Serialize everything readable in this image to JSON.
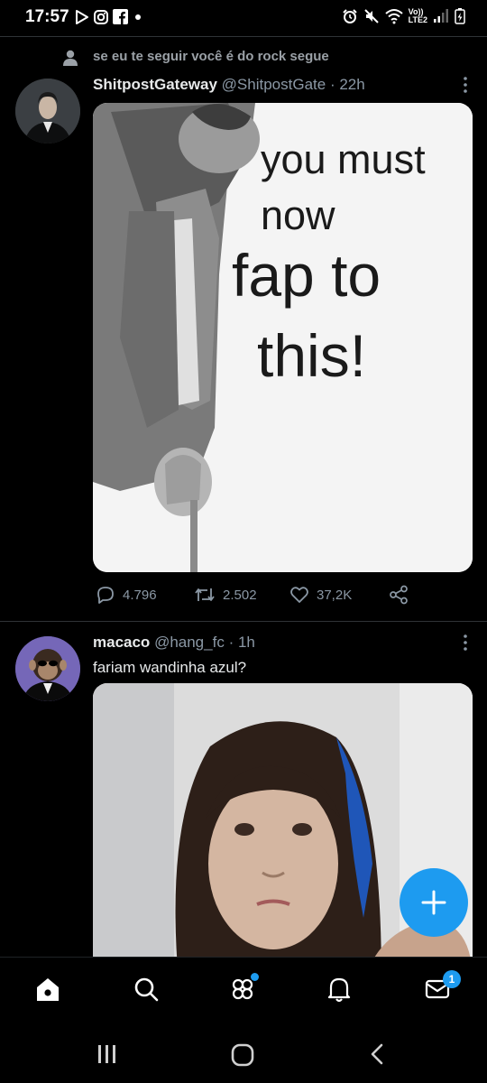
{
  "status_bar": {
    "time": "17:57",
    "network_top": "Vo))",
    "network_bottom": "LTE2"
  },
  "feed": {
    "tweets": [
      {
        "social_context": "se eu te seguir você é do rock segue",
        "name": "ShitpostGateway",
        "handle": "@ShitpostGate",
        "time": "· 22h",
        "media_text": [
          "you must",
          "now",
          "fap to",
          "this!"
        ],
        "stats": {
          "replies": "4.796",
          "retweets": "2.502",
          "likes": "37,2K"
        }
      },
      {
        "name": "macaco",
        "handle": "@hang_fc",
        "time": "· 1h",
        "text": "fariam wandinha azul?"
      }
    ]
  },
  "bottom_nav": {
    "items": [
      "home-icon",
      "search-icon",
      "communities-icon",
      "notifications-icon",
      "messages-icon"
    ],
    "messages_badge": "1"
  },
  "colors": {
    "accent": "#1d9bf0",
    "background": "#000000",
    "secondary_text": "#8b98a5",
    "divider": "#2f3336"
  }
}
